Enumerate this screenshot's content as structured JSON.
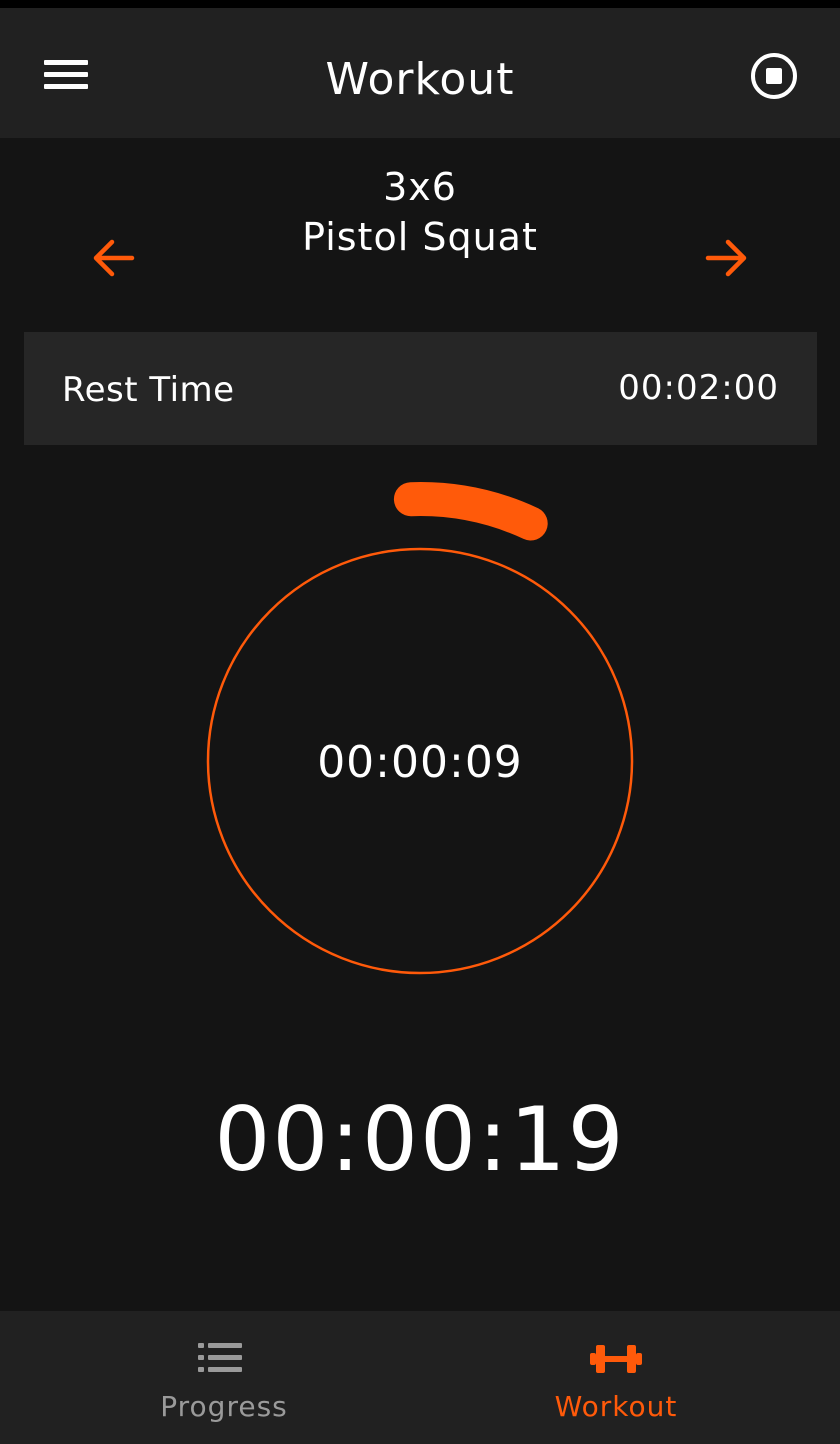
{
  "app_bar": {
    "title": "Workout",
    "menu_icon": "menu-icon",
    "stop_icon": "stop-circle-icon"
  },
  "exercise": {
    "sets_reps": "3x6",
    "name": "Pistol Squat",
    "prev_icon": "arrow-left-icon",
    "next_icon": "arrow-right-icon"
  },
  "rest": {
    "label": "Rest Time",
    "value": "00:02:00"
  },
  "timer": {
    "elapsed": "00:00:09",
    "progress_fraction": 0.075
  },
  "total_time": "00:00:19",
  "bottom_nav": {
    "items": [
      {
        "label": "Progress",
        "icon": "list-icon",
        "active": false
      },
      {
        "label": "Workout",
        "icon": "dumbbell-icon",
        "active": true
      }
    ]
  },
  "colors": {
    "accent": "#ff5a0a",
    "background": "#141414",
    "bar_background": "#212121",
    "row_background": "#262626",
    "inactive": "#9a9a9a"
  }
}
